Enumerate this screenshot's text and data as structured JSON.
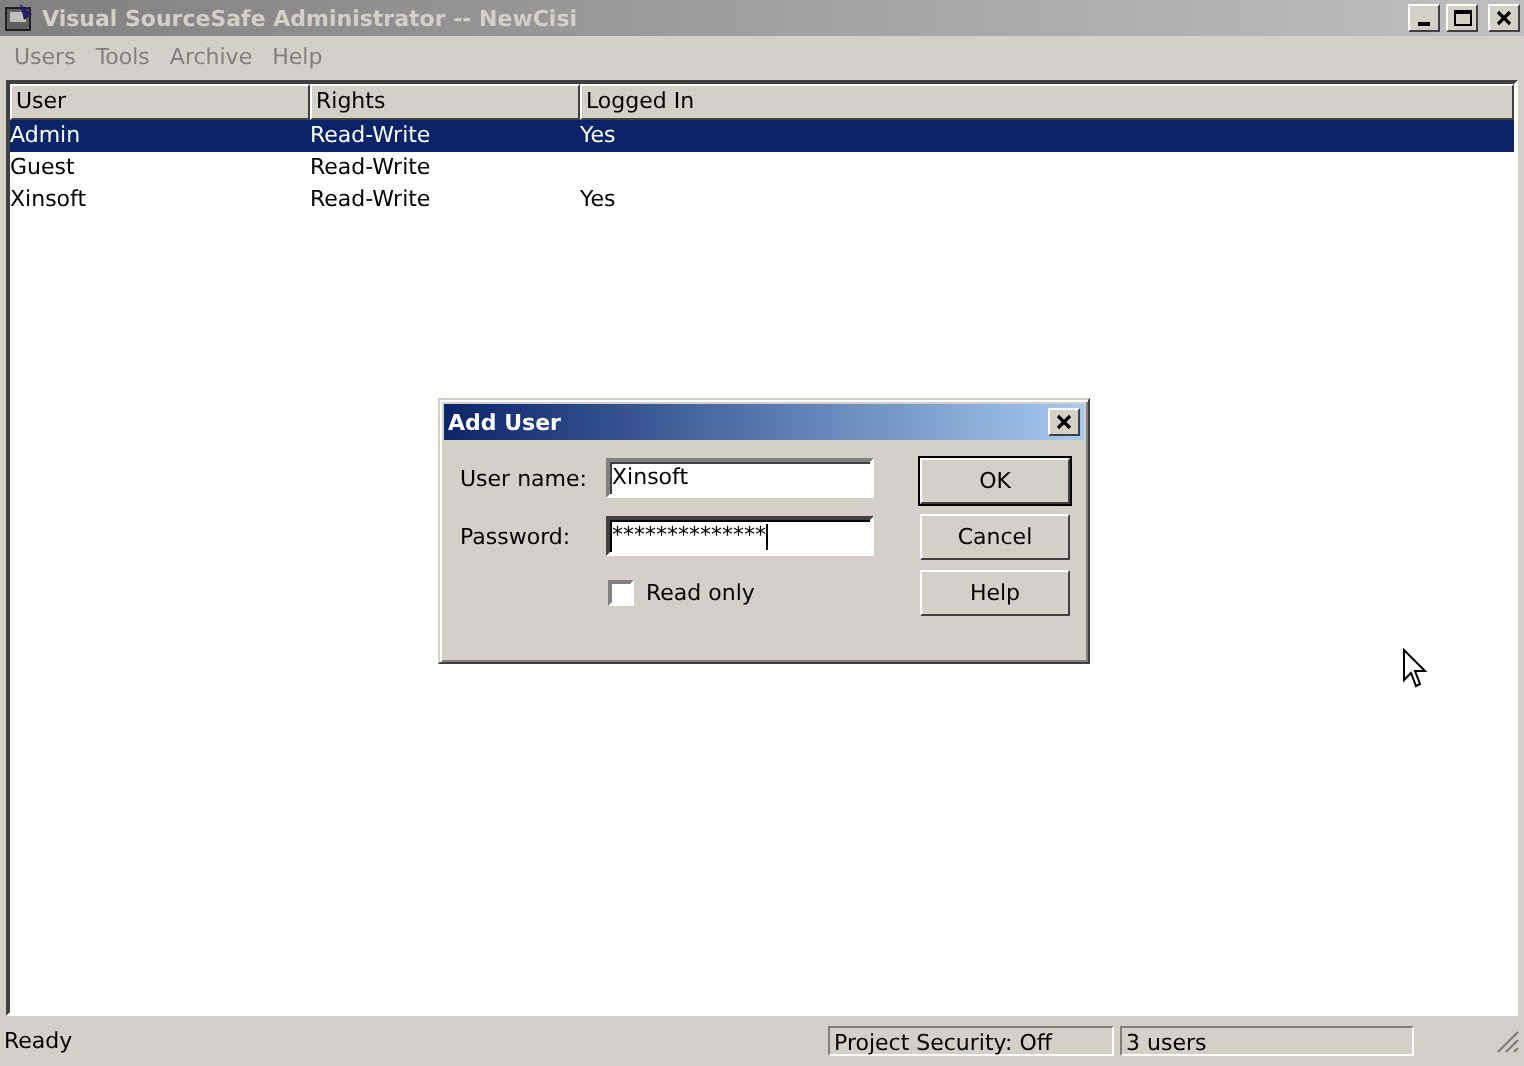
{
  "window": {
    "title": "Visual SourceSafe Administrator -- NewCisi",
    "active": false
  },
  "menu": [
    {
      "label": "Users",
      "disabled": true
    },
    {
      "label": "Tools",
      "disabled": true
    },
    {
      "label": "Archive",
      "disabled": true
    },
    {
      "label": "Help",
      "disabled": true
    }
  ],
  "table": {
    "columns": [
      "User",
      "Rights",
      "Logged In"
    ],
    "rows": [
      {
        "cells": [
          "Admin",
          "Read-Write",
          "Yes"
        ],
        "selected": true
      },
      {
        "cells": [
          "Guest",
          "Read-Write",
          ""
        ],
        "selected": false
      },
      {
        "cells": [
          "Xinsoft",
          "Read-Write",
          "Yes"
        ],
        "selected": false
      }
    ]
  },
  "dialog": {
    "title": "Add User",
    "fields": [
      {
        "label": "User name:",
        "value": "Xinsoft",
        "focused": false
      },
      {
        "label": "Password:",
        "value": "**************",
        "focused": true
      }
    ],
    "checkbox": {
      "label": "Read only",
      "checked": false
    },
    "buttons": [
      {
        "label": "OK",
        "default": true
      },
      {
        "label": "Cancel",
        "default": false
      },
      {
        "label": "Help",
        "default": false
      }
    ]
  },
  "status_bar": {
    "message": "Ready",
    "panes": [
      "Project Security: Off",
      "3 users"
    ]
  }
}
